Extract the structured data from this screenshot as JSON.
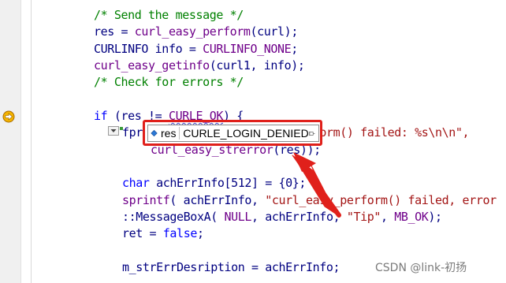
{
  "editor": {
    "lines": [
      [
        {
          "t": "/* Send the message */",
          "c": "comment"
        }
      ],
      [
        {
          "t": "res = ",
          "c": "plain"
        },
        {
          "t": "curl_easy_perform",
          "c": "macro"
        },
        {
          "t": "(curl);",
          "c": "plain"
        }
      ],
      [
        {
          "t": "CURLINFO info = ",
          "c": "plain"
        },
        {
          "t": "CURLINFO_NONE",
          "c": "macro"
        },
        {
          "t": ";",
          "c": "plain"
        }
      ],
      [
        {
          "t": "curl_easy_getinfo",
          "c": "macro"
        },
        {
          "t": "(curl1, info);",
          "c": "plain"
        }
      ],
      [
        {
          "t": "/* Check for errors */",
          "c": "comment"
        }
      ],
      [],
      [
        {
          "t": "if",
          "c": "kw"
        },
        {
          "t": " (res != ",
          "c": "plain"
        },
        {
          "t": "CURLE_OK",
          "c": "macro",
          "squiggle": true
        },
        {
          "t": ") {",
          "c": "plain"
        }
      ],
      [
        {
          "t": "fpr",
          "c": "plain"
        },
        {
          "t": "                       ",
          "c": "plain"
        },
        {
          "t": "erform() failed: %s\\n\\n\",",
          "c": "str"
        }
      ],
      [
        {
          "t": "curl_easy_strerror",
          "c": "macro"
        },
        {
          "t": "(res));",
          "c": "plain"
        }
      ],
      [],
      [
        {
          "t": "char",
          "c": "kw"
        },
        {
          "t": " achErrInfo[512] = {0};",
          "c": "plain"
        }
      ],
      [
        {
          "t": "sprintf",
          "c": "macro"
        },
        {
          "t": "( achErrInfo, ",
          "c": "plain"
        },
        {
          "t": "\"curl_easy_perform() failed, error",
          "c": "str"
        }
      ],
      [
        {
          "t": "::MessageBoxA( ",
          "c": "plain"
        },
        {
          "t": "NULL",
          "c": "macro"
        },
        {
          "t": ", achErrInfo, ",
          "c": "plain"
        },
        {
          "t": "\"Tip\"",
          "c": "str"
        },
        {
          "t": ", ",
          "c": "plain"
        },
        {
          "t": "MB_OK",
          "c": "macro"
        },
        {
          "t": ");",
          "c": "plain"
        }
      ],
      [
        {
          "t": "ret = ",
          "c": "plain"
        },
        {
          "t": "false",
          "c": "kw"
        },
        {
          "t": ";",
          "c": "plain"
        }
      ],
      [],
      [
        {
          "t": "m_strErrDesription = achErrInfo;",
          "c": "plain"
        }
      ]
    ]
  },
  "datatip": {
    "name": "res",
    "value": "CURLE_LOGIN_DENIED",
    "variable_icon": "field-icon",
    "pin_icon": "pin-icon"
  },
  "annotation": {
    "highlight_color": "#e0201b",
    "arrow_color": "#e0201b"
  },
  "watermark": "CSDN @link-初扬",
  "colors": {
    "comment": "#008000",
    "identifier": "#000080",
    "macro": "#6f008a",
    "string": "#a31515",
    "keyword": "#0000ff"
  }
}
